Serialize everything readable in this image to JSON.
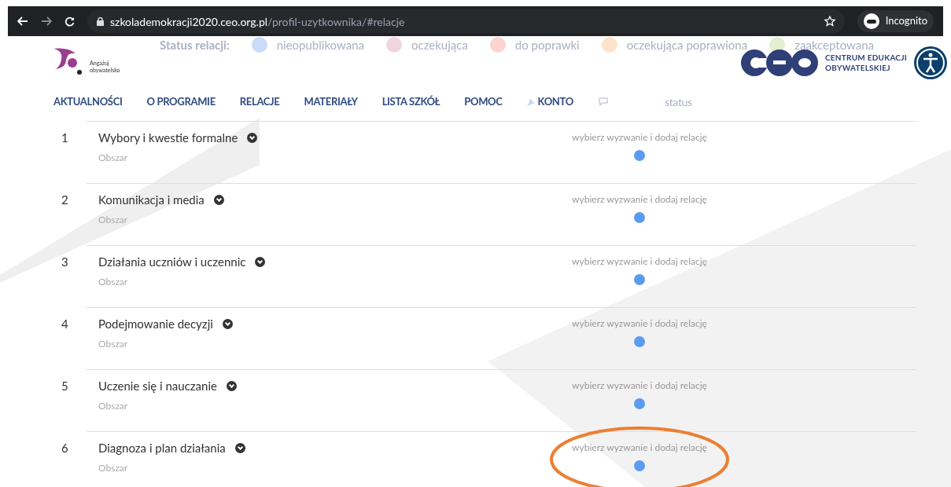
{
  "browser": {
    "url_host": "szkolademokracji2020.ceo.org.pl",
    "url_path": "/profil-uzytkownika/#relacje",
    "profile": "Incognito"
  },
  "legend": {
    "title": "Status relacji:",
    "items": [
      {
        "label": "nieopublikowana",
        "color": "#c9dcf8"
      },
      {
        "label": "oczekująca",
        "color": "#f0d6dc"
      },
      {
        "label": "do poprawki",
        "color": "#fcd3cf"
      },
      {
        "label": "oczekująca poprawiona",
        "color": "#fde3c9"
      },
      {
        "label": "zaakceptowana",
        "color": "#e3efd0"
      }
    ]
  },
  "brand": {
    "tagline_1": "Angażuj",
    "tagline_2": "obywatelsko",
    "org_1": "CENTRUM EDUKACJI",
    "org_2": "OBYWATELSKIEJ"
  },
  "nav": [
    "AKTUALNOŚCI",
    "O PROGRAMIE",
    "RELACJE",
    "MATERIAŁY",
    "LISTA SZKÓŁ",
    "POMOC",
    "KONTO"
  ],
  "table_header": {
    "status": "status"
  },
  "rows": [
    {
      "number": "1",
      "title": "Wybory i kwestie formalne",
      "subtitle": "Obszar",
      "action": "wybierz wyzwanie i dodaj relację",
      "color": "#5b9cf0"
    },
    {
      "number": "2",
      "title": "Komunikacja i media",
      "subtitle": "Obszar",
      "action": "wybierz wyzwanie i dodaj relację",
      "color": "#5b9cf0"
    },
    {
      "number": "3",
      "title": "Działania uczniów i uczennic",
      "subtitle": "Obszar",
      "action": "wybierz wyzwanie i dodaj relację",
      "color": "#5b9cf0"
    },
    {
      "number": "4",
      "title": "Podejmowanie decyzji",
      "subtitle": "Obszar",
      "action": "wybierz wyzwanie i dodaj relację",
      "color": "#5b9cf0"
    },
    {
      "number": "5",
      "title": "Uczenie się i nauczanie",
      "subtitle": "Obszar",
      "action": "wybierz wyzwanie i dodaj relację",
      "color": "#5b9cf0"
    },
    {
      "number": "6",
      "title": "Diagnoza i plan działania",
      "subtitle": "Obszar",
      "action": "wybierz wyzwanie i dodaj relację",
      "color": "#5b9cf0",
      "highlighted": true
    }
  ]
}
